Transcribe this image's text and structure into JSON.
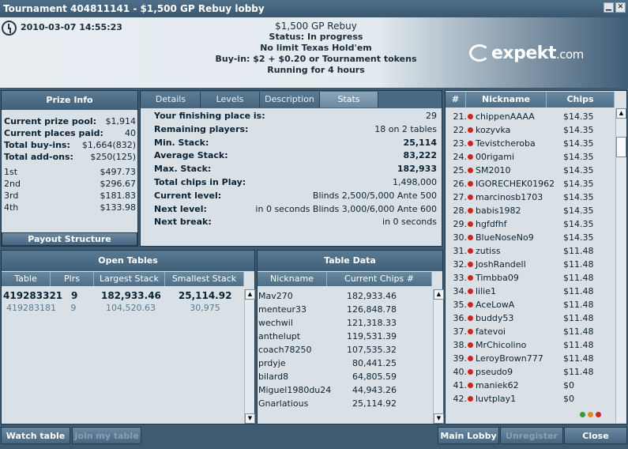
{
  "window": {
    "title": "Tournament 404811141 - $1,500 GP Rebuy lobby"
  },
  "header": {
    "datetime": "2010-03-07 14:55:23",
    "name": "$1,500 GP Rebuy",
    "status": "Status: In progress",
    "game": "No limit Texas Hold'em",
    "buyin": "Buy-in: $2 + $0.20 or Tournament tokens",
    "running": "Running for 4 hours",
    "logo": "expekt",
    "logo_suffix": ".com"
  },
  "prize": {
    "title": "Prize Info",
    "pool_label": "Current prize pool:",
    "pool": "$1,914",
    "places_label": "Current places paid:",
    "places": "40",
    "buyins_label": "Total buy-ins:",
    "buyins": "$1,664(832)",
    "addons_label": "Total add-ons:",
    "addons": "$250(125)",
    "places_list": [
      {
        "place": "1st",
        "amount": "$497.73"
      },
      {
        "place": "2nd",
        "amount": "$296.67"
      },
      {
        "place": "3rd",
        "amount": "$181.83"
      },
      {
        "place": "4th",
        "amount": "$133.98"
      }
    ],
    "payout_button": "Payout Structure"
  },
  "tabs": [
    "Details",
    "Levels",
    "Description",
    "Stats"
  ],
  "stats": [
    {
      "label": "Your finishing place is:",
      "value": "29",
      "bold": false
    },
    {
      "label": "Remaining players:",
      "value": "18 on 2 tables",
      "bold": false
    },
    {
      "label": "Min. Stack:",
      "value": "25,114",
      "bold": true
    },
    {
      "label": "Average Stack:",
      "value": "83,222",
      "bold": true
    },
    {
      "label": "Max. Stack:",
      "value": "182,933",
      "bold": true
    },
    {
      "label": "Total chips in Play:",
      "value": "1,498,000",
      "bold": false
    },
    {
      "label": "Current level:",
      "value": "Blinds 2,500/5,000 Ante 500",
      "bold": false
    },
    {
      "label": "Next level:",
      "value": "in 0 seconds Blinds 3,000/6,000 Ante 600",
      "bold": false
    },
    {
      "label": "Next break:",
      "value": "in 0 seconds",
      "bold": false
    }
  ],
  "players": {
    "headers": [
      "#",
      "Nickname",
      "Chips"
    ],
    "rows": [
      [
        "21.",
        "chippenAAAA",
        "$14.35"
      ],
      [
        "22.",
        "kozyvka",
        "$14.35"
      ],
      [
        "23.",
        "Tevistcheroba",
        "$14.35"
      ],
      [
        "24.",
        "00rigami",
        "$14.35"
      ],
      [
        "25.",
        "SM2010",
        "$14.35"
      ],
      [
        "26.",
        "IGORECHEK01962",
        "$14.35"
      ],
      [
        "27.",
        "marcinosb1703",
        "$14.35"
      ],
      [
        "28.",
        "babis1982",
        "$14.35"
      ],
      [
        "29.",
        "hgfdfhf",
        "$14.35"
      ],
      [
        "30.",
        "BlueNoseNo9",
        "$14.35"
      ],
      [
        "31.",
        "zutiss",
        "$11.48"
      ],
      [
        "32.",
        "JoshRandell",
        "$11.48"
      ],
      [
        "33.",
        "Timbba09",
        "$11.48"
      ],
      [
        "34.",
        "lilie1",
        "$11.48"
      ],
      [
        "35.",
        "AceLowA",
        "$11.48"
      ],
      [
        "36.",
        "buddy53",
        "$11.48"
      ],
      [
        "37.",
        "fatevoi",
        "$11.48"
      ],
      [
        "38.",
        "MrChicolino",
        "$11.48"
      ],
      [
        "39.",
        "LeroyBrown777",
        "$11.48"
      ],
      [
        "40.",
        "pseudo9",
        "$11.48"
      ],
      [
        "41.",
        "maniek62",
        "$0"
      ],
      [
        "42.",
        "luvtplay1",
        "$0"
      ]
    ],
    "colors": {
      "dot": "#c8281e",
      "green": "#2f9e2f",
      "orange": "#e08a1a",
      "red": "#c8281e"
    }
  },
  "open_tables": {
    "title": "Open Tables",
    "headers": [
      "Table",
      "Plrs",
      "Largest Stack",
      "Smallest Stack"
    ],
    "rows": [
      [
        "419283321",
        "9",
        "182,933.46",
        "25,114.92"
      ],
      [
        "419283181",
        "9",
        "104,520.63",
        "30,975"
      ]
    ]
  },
  "table_data": {
    "title": "Table Data",
    "headers": [
      "Nickname",
      "Current Chips #"
    ],
    "rows": [
      [
        "Mav270",
        "182,933.46"
      ],
      [
        "menteur33",
        "126,848.78"
      ],
      [
        "wechwil",
        "121,318.33"
      ],
      [
        "anthelupt",
        "119,531.39"
      ],
      [
        "coach78250",
        "107,535.32"
      ],
      [
        "prdyje",
        "80,441.25"
      ],
      [
        "bilard8",
        "64,805.59"
      ],
      [
        "Miguel1980du24",
        "44,943.26"
      ],
      [
        "Gnarlatious",
        "25,114.92"
      ]
    ]
  },
  "buttons": {
    "watch": "Watch table",
    "join": "Join my table",
    "lobby": "Main Lobby",
    "unregister": "Unregister",
    "close": "Close"
  }
}
